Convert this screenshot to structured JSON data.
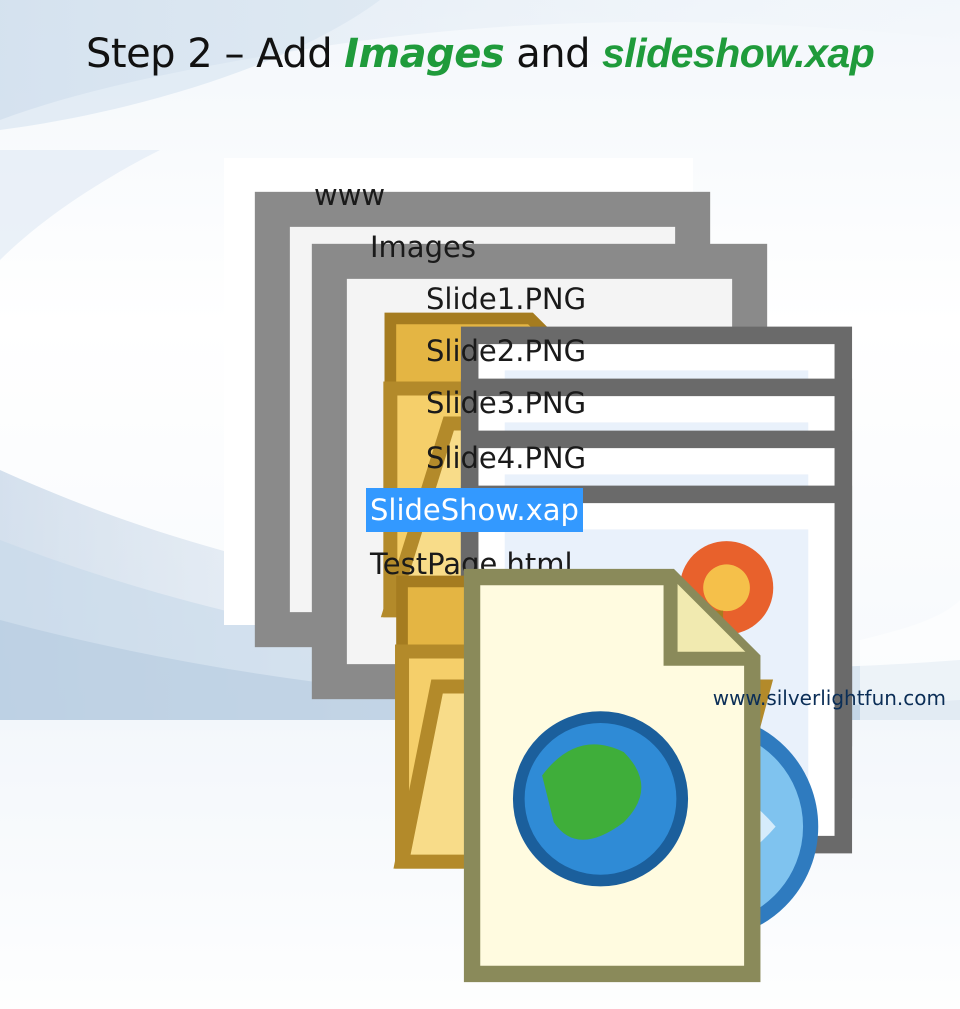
{
  "slide": {
    "title_part1": "Step 2 – Add",
    "title_part2": "Images",
    "title_part3": "and",
    "title_part4": "slideshow.xap",
    "footer_url": "www.silverlightfun.com"
  },
  "tree": {
    "root": {
      "label": "www",
      "icon": "folder-open-icon",
      "expanded": true
    },
    "images_folder": {
      "label": "Images",
      "icon": "folder-open-icon",
      "expanded": true
    },
    "images": [
      {
        "label": "Slide1.PNG",
        "icon": "image-file-icon"
      },
      {
        "label": "Slide2.PNG",
        "icon": "image-file-icon"
      },
      {
        "label": "Slide3.PNG",
        "icon": "image-file-icon"
      },
      {
        "label": "Slide4.PNG",
        "icon": "image-file-icon"
      }
    ],
    "xap_file": {
      "label": "SlideShow.xap",
      "icon": "xap-file-icon",
      "selected": true
    },
    "html_file": {
      "label": "TestPage.html",
      "icon": "html-file-icon"
    }
  },
  "colors": {
    "title_green": "#1f9b3b",
    "selection_blue": "#3399ff",
    "folder_yellow": "#f5c75a"
  }
}
